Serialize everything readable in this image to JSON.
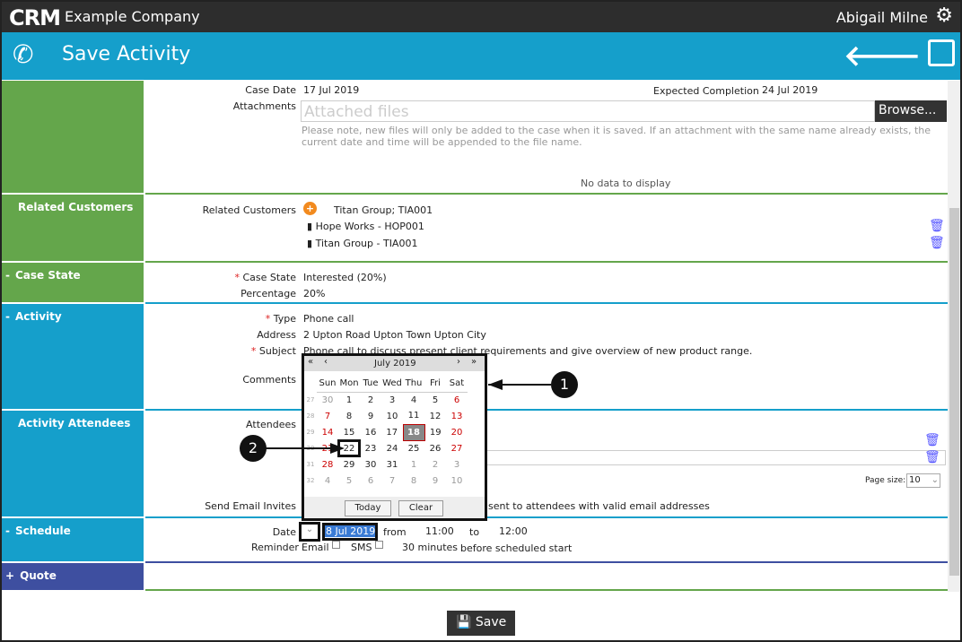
{
  "topbar": {
    "logo": "CRM",
    "company": "Example Company",
    "user": "Abigail Milne",
    "icons": [
      "gear-icon"
    ]
  },
  "header": {
    "title": "Save Activity",
    "icons": [
      "phone-icon",
      "back-arrow-icon",
      "save-icon"
    ]
  },
  "sections": {
    "related_customers": "Related Customers",
    "case_state": "Case State",
    "activity": "Activity",
    "activity_attendees": "Activity Attendees",
    "schedule": "Schedule",
    "quote": "Quote",
    "collapse": "-",
    "expand": "+"
  },
  "case": {
    "case_date_label": "Case Date",
    "case_date": "17 Jul 2019",
    "expected_label": "Expected Completion",
    "expected": "24 Jul 2019",
    "attachments_label": "Attachments",
    "attachments_placeholder": "Attached files",
    "browse": "Browse...",
    "note": "Please note, new files will only be added to the case when it is saved. If an attachment with the same name already exists, the current date and time will be appended to the file name.",
    "no_data": "No data to display"
  },
  "related": {
    "label": "Related Customers",
    "input": "Titan Group; TIA001",
    "items": [
      "Hope Works - HOP001",
      "Titan Group - TIA001"
    ]
  },
  "state": {
    "label": "Case State",
    "value": "Interested (20%)",
    "pct_label": "Percentage",
    "pct": "20%",
    "req": "*"
  },
  "activity": {
    "type_label": "Type",
    "type": "Phone call",
    "address_label": "Address",
    "address": "2 Upton Road Upton Town Upton City",
    "subject_label": "Subject",
    "subject": "Phone call to discuss present client requirements and give overview of new product range.",
    "comments_label": "Comments"
  },
  "attendees": {
    "label": "Attendees",
    "page_size_label": "Page size:",
    "page_size": "10",
    "invites_label": "Send Email Invites",
    "invites_text": "sent to attendees with valid email addresses"
  },
  "schedule": {
    "date_label": "Date",
    "date": "18 Jul 2019",
    "from": "from",
    "start": "11:00",
    "to": "to",
    "end": "12:00",
    "reminder_label": "Reminder",
    "email": "Email",
    "sms": "SMS",
    "minutes": "30 minutes",
    "before": "before scheduled start"
  },
  "calendar": {
    "month": "July 2019",
    "prev_year": "«",
    "prev": "‹",
    "next": "›",
    "next_year": "»",
    "days": [
      "Sun",
      "Mon",
      "Tue",
      "Wed",
      "Thu",
      "Fri",
      "Sat"
    ],
    "weeks": [
      {
        "n": "27",
        "d": [
          30,
          1,
          2,
          3,
          4,
          5,
          6
        ]
      },
      {
        "n": "28",
        "d": [
          7,
          8,
          9,
          10,
          11,
          12,
          13
        ]
      },
      {
        "n": "29",
        "d": [
          14,
          15,
          16,
          17,
          18,
          19,
          20
        ]
      },
      {
        "n": "30",
        "d": [
          21,
          22,
          23,
          24,
          25,
          26,
          27
        ]
      },
      {
        "n": "31",
        "d": [
          28,
          29,
          30,
          31,
          1,
          2,
          3
        ]
      },
      {
        "n": "32",
        "d": [
          4,
          5,
          6,
          7,
          8,
          9,
          10
        ]
      }
    ],
    "today": 18,
    "highlighted": 22,
    "today_btn": "Today",
    "clear_btn": "Clear"
  },
  "annotations": [
    "1",
    "2"
  ],
  "footer": {
    "save": "Save"
  }
}
